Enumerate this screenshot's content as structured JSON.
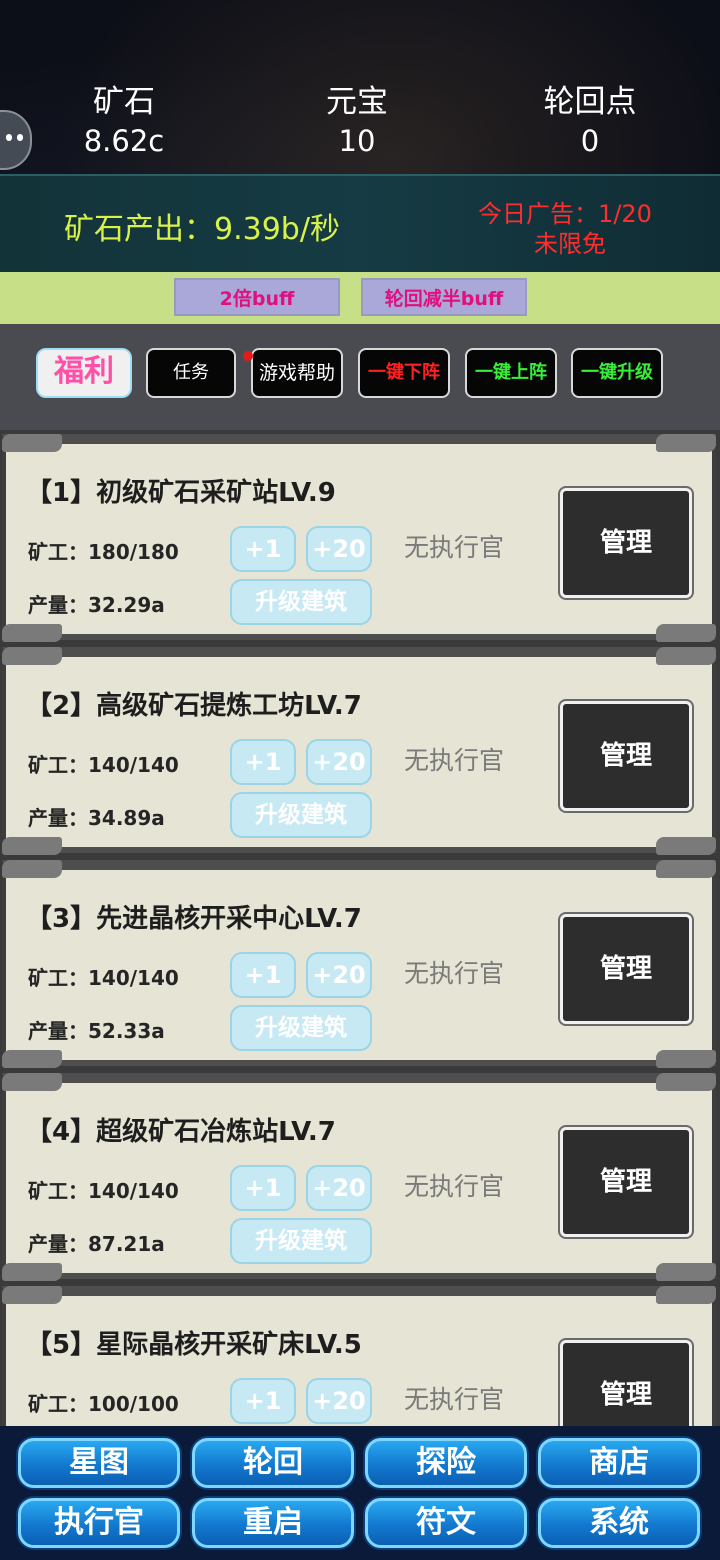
{
  "resources": {
    "ore": {
      "label": "矿石",
      "value": "8.62c"
    },
    "gold": {
      "label": "元宝",
      "value": "10"
    },
    "cycle": {
      "label": "轮回点",
      "value": "0"
    }
  },
  "production": {
    "text": "矿石产出：9.39b/秒",
    "ad_count": "今日广告：1/20",
    "ad_status": "未限免"
  },
  "buffs": [
    "2倍buff",
    "轮回减半buff"
  ],
  "actions": {
    "welfare": "福利",
    "task": "任务",
    "help": "游戏帮助",
    "one_down": "一键下阵",
    "one_up": "一键上阵",
    "one_upgrade": "一键升级"
  },
  "colors": {
    "production_text": "#d8f24a",
    "ad_text": "#ff2e2e",
    "buff_text": "#e0107e",
    "welfare_text": "#ff4fa7",
    "green_action": "#39ee39",
    "red_action": "#ff2020"
  },
  "buildings": [
    {
      "title": "【1】初级矿石采矿站LV.9",
      "miners": "矿工：180/180",
      "output": "产量：32.29a",
      "plus1": "+1",
      "plus20": "+20",
      "upgrade": "升级建筑",
      "exec": "无执行官",
      "manage": "管理"
    },
    {
      "title": "【2】高级矿石提炼工坊LV.7",
      "miners": "矿工：140/140",
      "output": "产量：34.89a",
      "plus1": "+1",
      "plus20": "+20",
      "upgrade": "升级建筑",
      "exec": "无执行官",
      "manage": "管理"
    },
    {
      "title": "【3】先进晶核开采中心LV.7",
      "miners": "矿工：140/140",
      "output": "产量：52.33a",
      "plus1": "+1",
      "plus20": "+20",
      "upgrade": "升级建筑",
      "exec": "无执行官",
      "manage": "管理"
    },
    {
      "title": "【4】超级矿石冶炼站LV.7",
      "miners": "矿工：140/140",
      "output": "产量：87.21a",
      "plus1": "+1",
      "plus20": "+20",
      "upgrade": "升级建筑",
      "exec": "无执行官",
      "manage": "管理"
    },
    {
      "title": "【5】星际晶核开采矿床LV.5",
      "miners": "矿工：100/100",
      "output": "",
      "plus1": "+1",
      "plus20": "+20",
      "upgrade": "",
      "exec": "无执行官",
      "manage": "管理"
    }
  ],
  "bottom_nav": [
    [
      "星图",
      "轮回",
      "探险",
      "商店"
    ],
    [
      "执行官",
      "重启",
      "符文",
      "系统"
    ]
  ]
}
